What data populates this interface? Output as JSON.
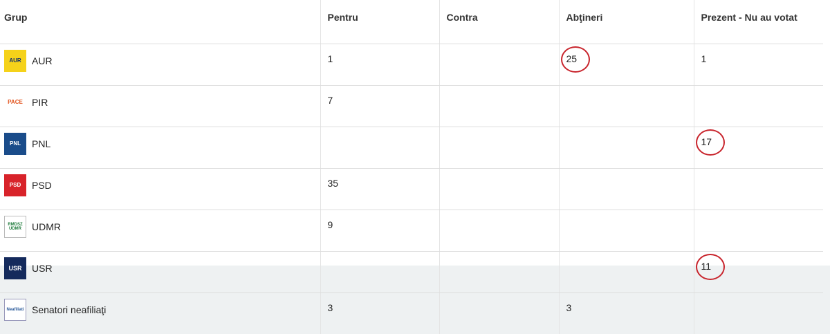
{
  "table": {
    "headers": [
      "Grup",
      "Pentru",
      "Contra",
      "Abţineri",
      "Prezent - Nu au votat"
    ],
    "rows": [
      {
        "group": "AUR",
        "logo_text": "AUR",
        "logo_icon": "aur-logo-icon",
        "pentru": "1",
        "contra": "",
        "abtineri": "25",
        "prezent": "1",
        "circled": "abtineri"
      },
      {
        "group": "PIR",
        "logo_text": "PACE",
        "logo_icon": "pace-logo-icon",
        "pentru": "7",
        "contra": "",
        "abtineri": "",
        "prezent": "",
        "circled": ""
      },
      {
        "group": "PNL",
        "logo_text": "PNL",
        "logo_icon": "pnl-logo-icon",
        "pentru": "",
        "contra": "",
        "abtineri": "",
        "prezent": "17",
        "circled": "prezent"
      },
      {
        "group": "PSD",
        "logo_text": "PSD",
        "logo_icon": "psd-logo-icon",
        "pentru": "35",
        "contra": "",
        "abtineri": "",
        "prezent": "",
        "circled": ""
      },
      {
        "group": "UDMR",
        "logo_text": "RMDSZ UDMR",
        "logo_icon": "udmr-logo-icon",
        "pentru": "9",
        "contra": "",
        "abtineri": "",
        "prezent": "",
        "circled": ""
      },
      {
        "group": "USR",
        "logo_text": "USR",
        "logo_icon": "usr-logo-icon",
        "pentru": "",
        "contra": "",
        "abtineri": "",
        "prezent": "11",
        "circled": "prezent"
      },
      {
        "group": "Senatori neafiliaţi",
        "logo_text": "Neafiliati",
        "logo_icon": "neafiliati-logo-icon",
        "pentru": "3",
        "contra": "",
        "abtineri": "3",
        "prezent": "",
        "circled": ""
      }
    ]
  },
  "colors": {
    "aur": "#f5d21a",
    "pace": "#e2521b",
    "pnl": "#1a4c8a",
    "psd": "#d8232a",
    "udmr": "#1c7a3a",
    "usr": "#142a5c",
    "annotation": "#c8242c"
  }
}
